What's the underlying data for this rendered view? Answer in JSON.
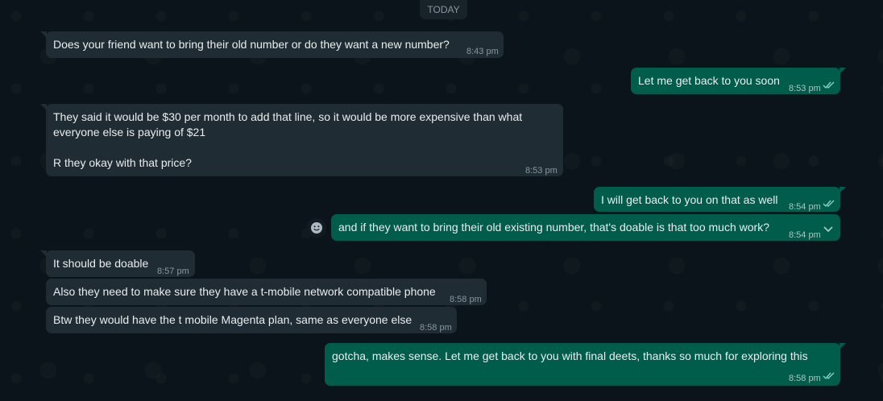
{
  "date_chip": "TODAY",
  "messages": [
    {
      "dir": "in",
      "text": "Does your friend want to bring their old number or do they want a new number?",
      "time": "8:43 pm"
    },
    {
      "dir": "out",
      "text": "Let me get back to you soon",
      "time": "8:53 pm"
    },
    {
      "dir": "in",
      "text": "They said it would be $30 per month to add that line, so it would be more expensive than what\neveryone else is paying of $21\n\nR they okay with that price?",
      "time": "8:53 pm"
    },
    {
      "dir": "out",
      "text": "I will get back to you on that as well",
      "time": "8:54 pm"
    },
    {
      "dir": "out",
      "text": "and if they want to bring their old existing number, that's doable is that too much work?",
      "time": "8:54 pm"
    },
    {
      "dir": "in",
      "text": "It should be doable",
      "time": "8:57 pm"
    },
    {
      "dir": "in",
      "text": "Also they need to make sure they have a t-mobile network compatible phone",
      "time": "8:58 pm"
    },
    {
      "dir": "in",
      "text": "Btw they would have the t mobile Magenta plan, same as everyone else",
      "time": "8:58 pm"
    },
    {
      "dir": "out",
      "text": "gotcha, makes sense. Let me get back to you with final deets, thanks so much for exploring this",
      "time": "8:58 pm"
    }
  ],
  "icons": {
    "read_receipt": "double-check-icon",
    "menu": "chevron-down-icon",
    "reaction": "emoji-icon"
  },
  "colors": {
    "incoming": "#202c33",
    "outgoing": "#005c4b",
    "background": "#0b141a",
    "tick": "#8bd1c3"
  }
}
